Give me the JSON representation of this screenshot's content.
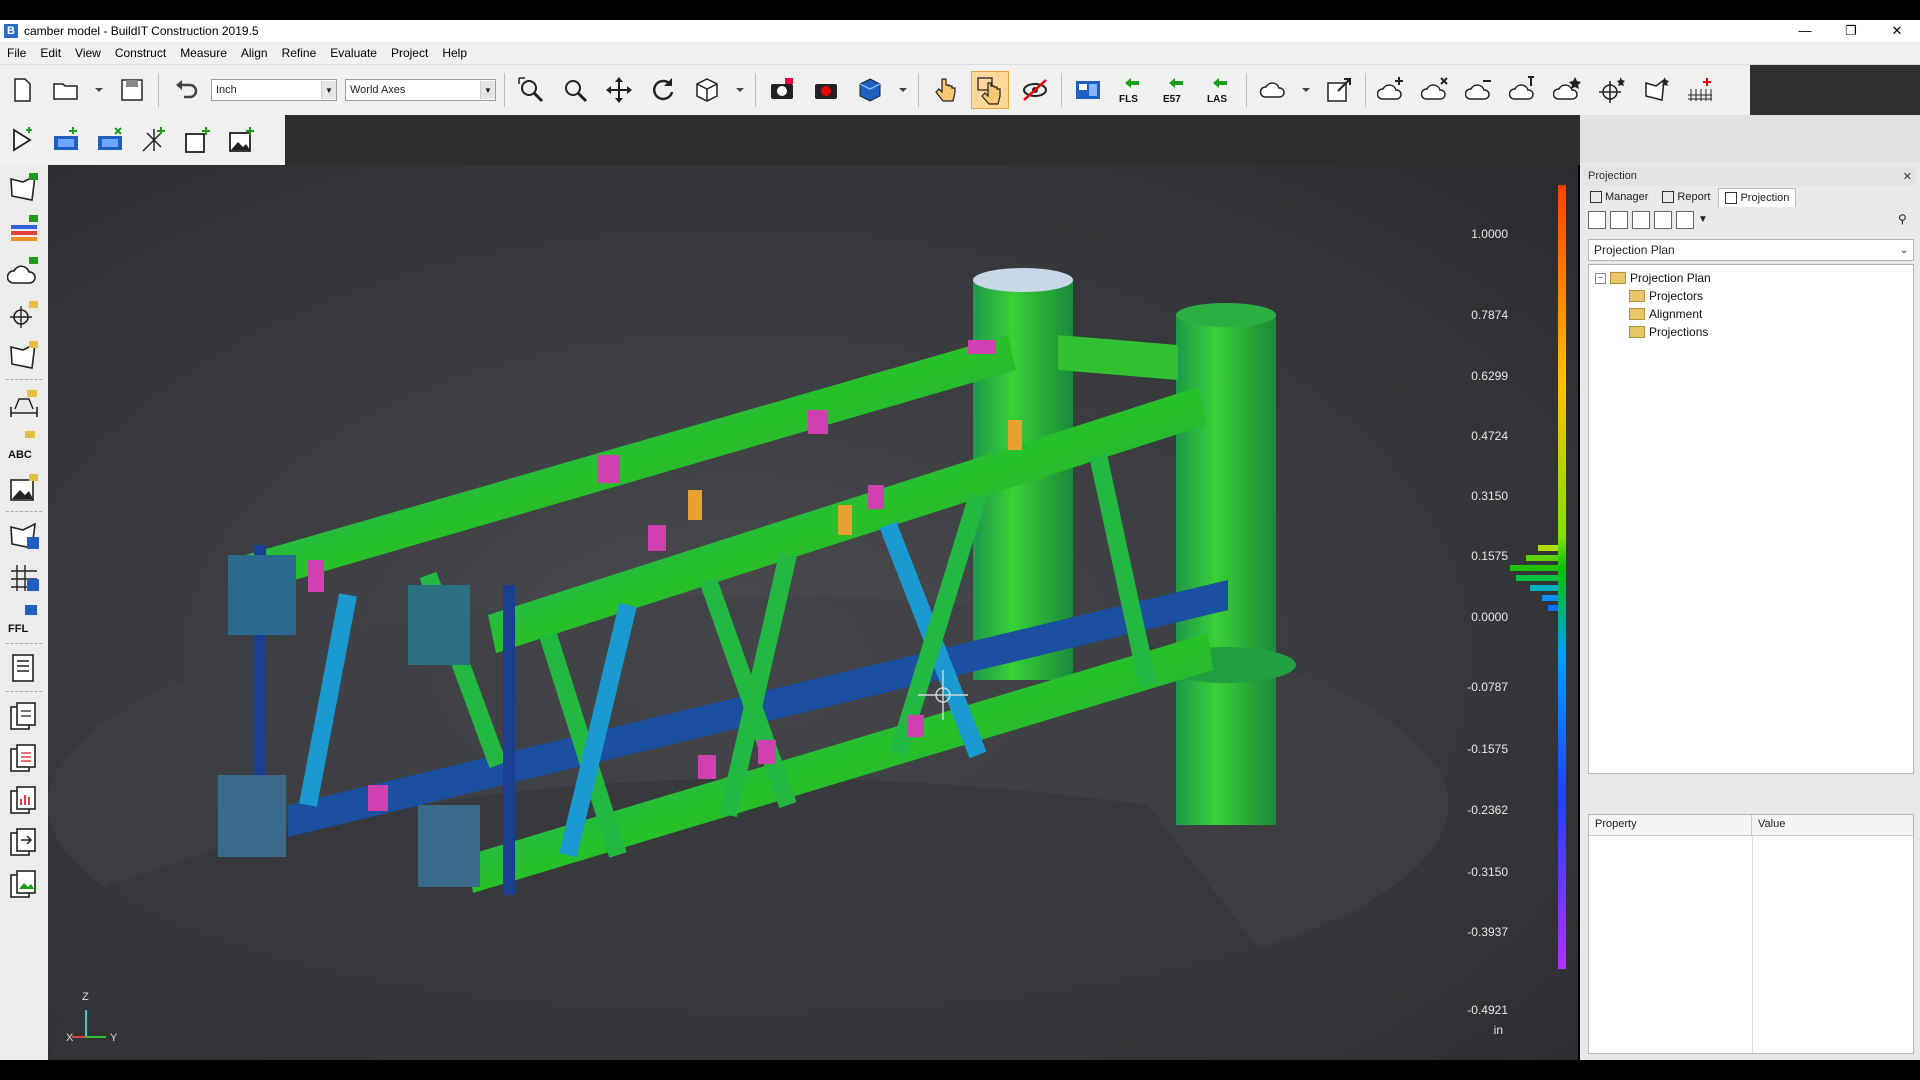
{
  "window": {
    "title": "camber model - BuildIT Construction 2019.5",
    "app_icon_letter": "B",
    "controls": [
      "—",
      "❐",
      "✕"
    ]
  },
  "menu": [
    "File",
    "Edit",
    "View",
    "Construct",
    "Measure",
    "Align",
    "Refine",
    "Evaluate",
    "Project",
    "Help"
  ],
  "toolbar": {
    "units_value": "Inch",
    "axes_value": "World Axes",
    "fls_label": "FLS",
    "e57_label": "E57",
    "las_label": "LAS"
  },
  "left_toolbar": {
    "abc_label": "ABC",
    "ffl_label": "FFL"
  },
  "viewport": {
    "scale": {
      "labels": [
        "1.0000",
        "0.7874",
        "0.6299",
        "0.4724",
        "0.3150",
        "0.1575",
        "0.0000",
        "-0.0787",
        "-0.1575",
        "-0.2362",
        "-0.3150",
        "-0.3937",
        "-0.4921"
      ],
      "unit": "in"
    },
    "axis": {
      "z": "Z",
      "x": "X",
      "y": "Y"
    },
    "colors": {
      "scale_top": "#ff4000",
      "scale_mid": "#00c000",
      "scale_bottom": "#9b30ff"
    }
  },
  "right_panel": {
    "header_title": "Projection",
    "tabs": [
      {
        "label": "Manager"
      },
      {
        "label": "Report"
      },
      {
        "label": "Projection"
      }
    ],
    "plan_combo": "Projection Plan",
    "tree": {
      "root": "Projection Plan",
      "children": [
        "Projectors",
        "Alignment",
        "Projections"
      ]
    },
    "property_table": {
      "col_property": "Property",
      "col_value": "Value"
    }
  }
}
